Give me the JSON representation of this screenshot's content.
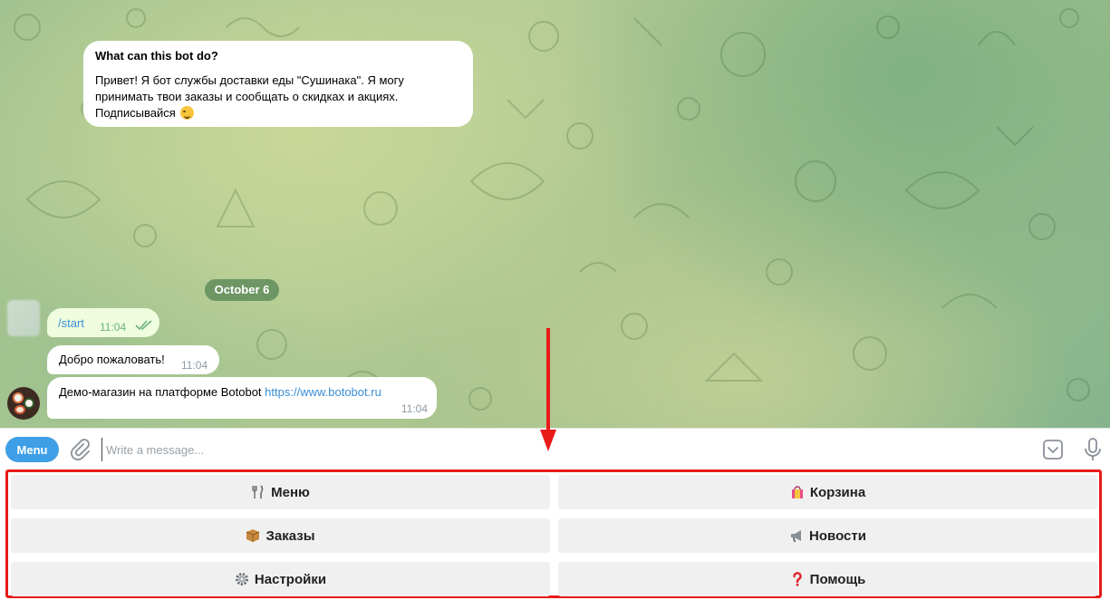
{
  "bot_info": {
    "title": "What can this bot do?",
    "line1": "Привет! Я бот службы доставки еды \"Сушинака\". Я могу",
    "line2": "принимать твои заказы и сообщать о скидках и акциях.",
    "line3": "Подписывайся"
  },
  "date_divider": "October 6",
  "messages": [
    {
      "text": "/start",
      "time": "11:04"
    },
    {
      "text": "Добро пожаловать!",
      "time": "11:04"
    },
    {
      "text": "Демо-магазин на платформе Botobot",
      "link": "https://www.botobot.ru",
      "time": "11:04"
    }
  ],
  "input_bar": {
    "menu_label": "Menu",
    "placeholder": "Write a message..."
  },
  "keyboard": {
    "buttons": [
      {
        "label": "Меню",
        "icon": "fork-knife-icon"
      },
      {
        "label": "Корзина",
        "icon": "shopping-bag-icon"
      },
      {
        "label": "Заказы",
        "icon": "package-icon"
      },
      {
        "label": "Новости",
        "icon": "megaphone-icon"
      },
      {
        "label": "Настройки",
        "icon": "gear-icon"
      },
      {
        "label": "Помощь",
        "icon": "question-mark-icon"
      }
    ]
  },
  "colors": {
    "accent": "#3e9fe6",
    "highlight": "#e81a1a",
    "link": "#3a8fd6"
  }
}
